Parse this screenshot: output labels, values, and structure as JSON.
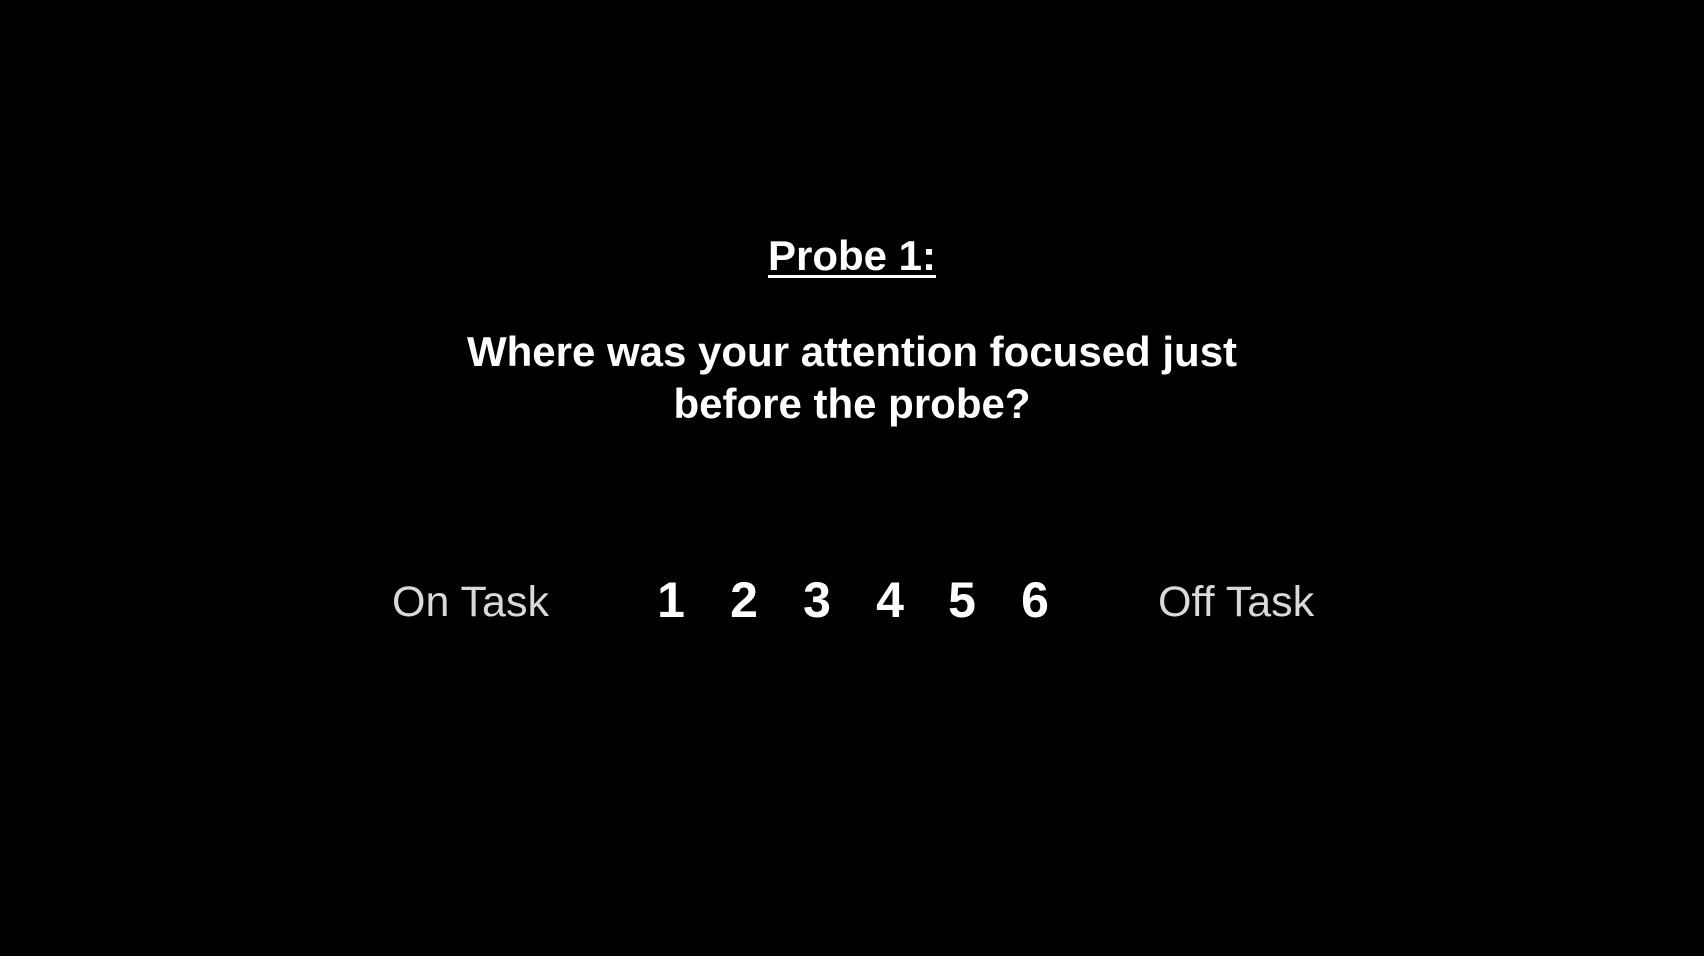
{
  "probe": {
    "title": "Probe 1:",
    "question": "Where was your attention focused just before the probe?"
  },
  "scale": {
    "left_label": "On Task",
    "right_label": "Off Task",
    "options": [
      "1",
      "2",
      "3",
      "4",
      "5",
      "6"
    ]
  },
  "colors": {
    "background": "#000000",
    "text_primary": "#ffffff",
    "text_secondary": "#d9d9d9"
  }
}
